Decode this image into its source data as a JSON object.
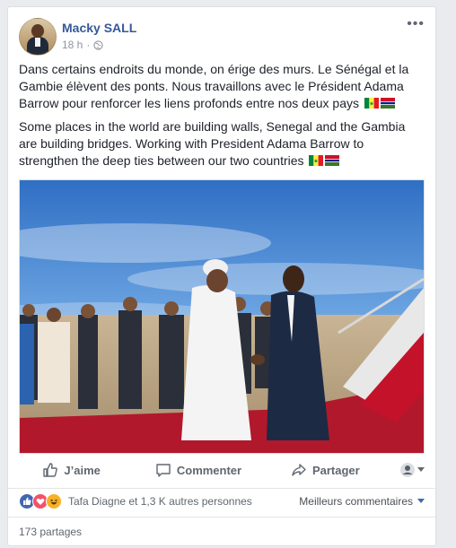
{
  "post": {
    "author": "Macky SALL",
    "time": "18 h",
    "text_fr": "Dans certains endroits du monde, on érige des murs. Le Sénégal et la Gambie élèvent des ponts. Nous travaillons avec le Président Adama Barrow pour renforcer les liens profonds entre nos deux pays",
    "text_en": "Some places in the world are building walls, Senegal and the Gambia are building bridges. Working with President Adama Barrow to strengthen the deep ties between our two countries",
    "more_label": "•••"
  },
  "actions": {
    "like": "J’aime",
    "comment": "Commenter",
    "share": "Partager"
  },
  "reactions": {
    "summary": "Tafa Diagne et 1,3 K autres personnes",
    "sort_label": "Meilleurs commentaires",
    "shares": "173 partages"
  },
  "colors": {
    "link_blue": "#365899",
    "fb_blue": "#4267b2",
    "love_red": "#f25268",
    "haha_yellow": "#f7b125"
  },
  "icons": [
    "globe-icon",
    "like-icon",
    "comment-icon",
    "share-icon",
    "audience-icon",
    "caret-down-icon",
    "senegal-flag-icon",
    "gambia-flag-icon"
  ]
}
